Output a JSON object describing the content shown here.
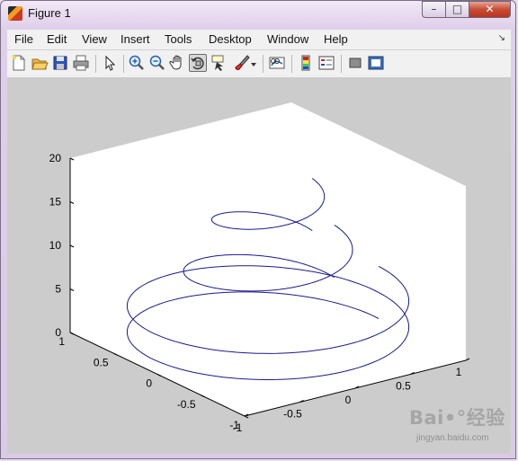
{
  "window": {
    "title": "Figure 1",
    "minimize": "–",
    "maximize": "□",
    "close": "✕"
  },
  "menu": {
    "items": [
      "File",
      "Edit",
      "View",
      "Insert",
      "Tools",
      "Desktop",
      "Window",
      "Help"
    ],
    "dock_arrow": "↘"
  },
  "toolbar": {
    "icons": [
      "new-figure-icon",
      "open-file-icon",
      "save-icon",
      "print-icon",
      "edit-plot-arrow-icon",
      "zoom-in-icon",
      "zoom-out-icon",
      "pan-hand-icon",
      "rotate-3d-icon",
      "data-cursor-icon",
      "brush-icon",
      "brush-dropdown-icon",
      "link-plot-icon",
      "colorbar-icon",
      "legend-icon",
      "hide-plot-tools-icon",
      "show-plot-tools-icon"
    ],
    "active": "rotate-3d-icon"
  },
  "chart_data": {
    "type": "line3d",
    "title": "",
    "xlabel": "",
    "ylabel": "",
    "zlabel": "",
    "xlim": [
      -1,
      1
    ],
    "ylim": [
      -1,
      1
    ],
    "zlim": [
      0,
      20
    ],
    "x_ticks": [
      "-1",
      "-0.5",
      "0",
      "0.5",
      "1"
    ],
    "y_ticks": [
      "-1",
      "-0.5",
      "0",
      "0.5",
      "1"
    ],
    "z_ticks": [
      "0",
      "5",
      "10",
      "15",
      "20"
    ],
    "series": [
      {
        "equation": "x = cos(t), y = sin(t), z = 3 t / (2π)",
        "t_range": [
          0,
          12.566
        ],
        "z_range": [
          0,
          6
        ],
        "color": "#1a1a8c",
        "radius": 1.0
      },
      {
        "equation": "x = 0.6 cos(t), y = 0.6 sin(t), z = 6 + 6 t / (2π)",
        "t_range": [
          0,
          6.283
        ],
        "z_range": [
          6,
          12
        ],
        "color": "#1a1a8c",
        "radius": 0.6
      },
      {
        "equation": "x = 0.4 cos(t), y = 0.4 sin(t), z = 12 + 6 t / (2π)",
        "t_range": [
          0,
          6.283
        ],
        "z_range": [
          12,
          18
        ],
        "color": "#1a1a8c",
        "radius": 0.4
      }
    ],
    "grid": false,
    "background_color": "#ffffff",
    "figure_color": "#cccccc"
  },
  "watermark": {
    "logo": "Bai•°经验",
    "url": "jingyan.baidu.com"
  }
}
